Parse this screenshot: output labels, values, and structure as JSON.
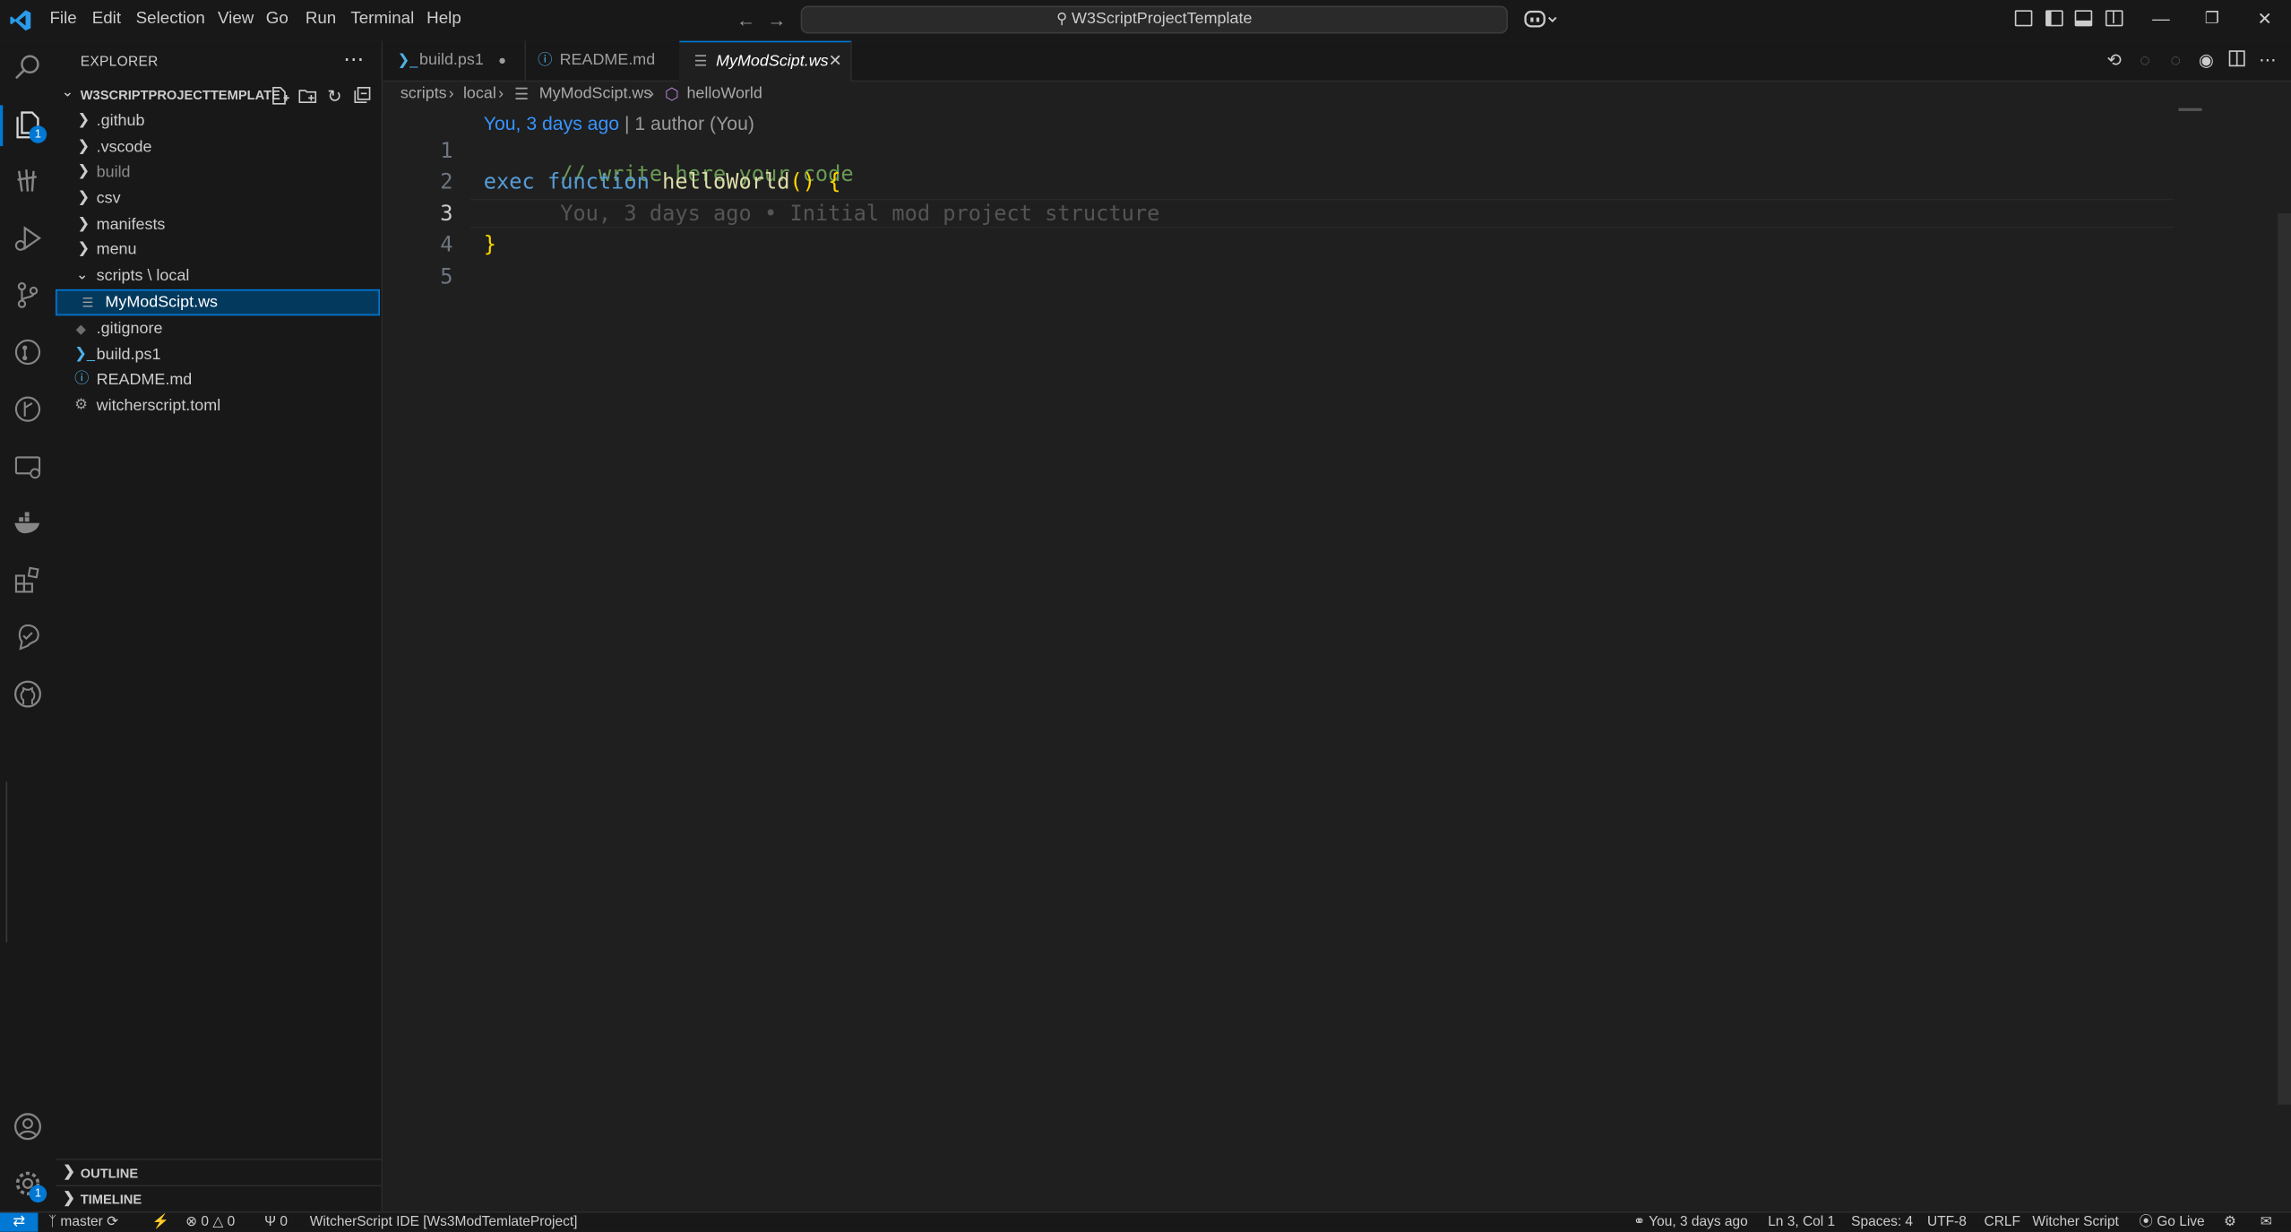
{
  "menu": [
    "File",
    "Edit",
    "Selection",
    "View",
    "Go",
    "Run",
    "Terminal",
    "Help"
  ],
  "command_center": "W3ScriptProjectTemplate",
  "explorer": {
    "title": "EXPLORER",
    "more": "⋯",
    "project": "W3SCRIPTPROJECTTEMPLATE",
    "items": [
      {
        "label": ".github",
        "type": "folder"
      },
      {
        "label": ".vscode",
        "type": "folder"
      },
      {
        "label": "build",
        "type": "folder"
      },
      {
        "label": "csv",
        "type": "folder"
      },
      {
        "label": "manifests",
        "type": "folder"
      },
      {
        "label": "menu",
        "type": "folder"
      },
      {
        "label": "scripts \\ local",
        "type": "folder-open"
      },
      {
        "label": "MyModScipt.ws",
        "type": "file"
      },
      {
        "label": ".gitignore",
        "type": "file"
      },
      {
        "label": "build.ps1",
        "type": "file"
      },
      {
        "label": "README.md",
        "type": "file"
      },
      {
        "label": "witcherscript.toml",
        "type": "file"
      }
    ],
    "outline": "OUTLINE",
    "timeline": "TIMELINE"
  },
  "tabs": [
    {
      "label": "build.ps1",
      "modified": "●"
    },
    {
      "label": "README.md"
    },
    {
      "label": "MyModScipt.ws",
      "close": "✕"
    }
  ],
  "breadcrumbs": [
    "scripts",
    "local",
    "MyModScipt.ws",
    "helloWorld"
  ],
  "codelens": {
    "when": "You, 3 days ago",
    "sep": " | ",
    "authors": "1 author (You)"
  },
  "code": {
    "line1": "// write here your code",
    "line2_kw1": "exec",
    "line2_kw2": "function",
    "line2_fn": "helloWorld",
    "line2_paren": "()",
    "line2_brace": "{",
    "line3_blame": "You, 3 days ago • Initial mod project structure",
    "line4": "}",
    "line_numbers": [
      "1",
      "2",
      "3",
      "4",
      "5"
    ]
  },
  "activity_badges": {
    "explorer": "1",
    "settings": "1"
  },
  "status": {
    "branch": "master",
    "problems": "0",
    "warnings": "0",
    "ports": "0",
    "ide": "WitcherScript IDE [Ws3ModTemlateProject]",
    "blame": "You, 3 days ago",
    "position": "Ln 3, Col 1",
    "spaces": "Spaces: 4",
    "encoding": "UTF-8",
    "eol": "CRLF",
    "language": "Witcher Script",
    "golive": "Go Live"
  }
}
